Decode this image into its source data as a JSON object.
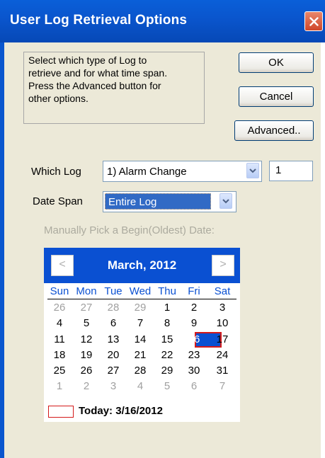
{
  "window": {
    "title": "User Log Retrieval Options"
  },
  "description": {
    "lines": [
      "Select which type of Log to",
      "retrieve and for what time span.",
      "Press the Advanced button for",
      "other options."
    ]
  },
  "buttons": {
    "ok": "OK",
    "cancel": "Cancel",
    "advanced": "Advanced.."
  },
  "which_log": {
    "label": "Which Log",
    "selected": "1) Alarm Change",
    "count": "1"
  },
  "date_span": {
    "label": "Date Span",
    "selected": "Entire Log"
  },
  "hint": "Manually Pick a Begin(Oldest) Date:",
  "calendar": {
    "month_label": "March, 2012",
    "prev": "<",
    "next": ">",
    "weekdays": [
      "Sun",
      "Mon",
      "Tue",
      "Wed",
      "Thu",
      "Fri",
      "Sat"
    ],
    "weeks": [
      [
        "26",
        "27",
        "28",
        "29",
        "1",
        "2",
        "3"
      ],
      [
        "4",
        "5",
        "6",
        "7",
        "8",
        "9",
        "10"
      ],
      [
        "11",
        "12",
        "13",
        "14",
        "15",
        "16",
        "17"
      ],
      [
        "18",
        "19",
        "20",
        "21",
        "22",
        "23",
        "24"
      ],
      [
        "25",
        "26",
        "27",
        "28",
        "29",
        "30",
        "31"
      ],
      [
        "1",
        "2",
        "3",
        "4",
        "5",
        "6",
        "7"
      ]
    ],
    "today_label": "Today: 3/16/2012",
    "selected_day": "16"
  },
  "colors": {
    "titlebar": "#0a56ce",
    "calendar_header": "#0a50d2",
    "selection": "#316ac5",
    "today_outline": "#d41a1a"
  }
}
